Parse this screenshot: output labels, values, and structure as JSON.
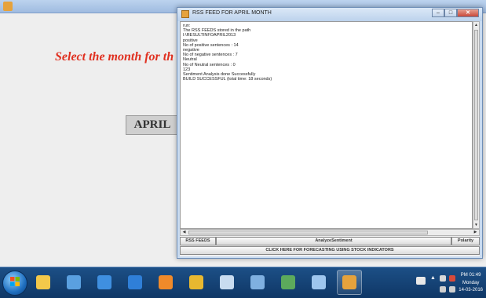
{
  "background_app": {
    "prompt_text": "Select the month for th",
    "month_button_label": "APRIL"
  },
  "rss_window": {
    "title": "RSS FEED FOR APRIL MONTH",
    "window_controls": {
      "minimize": "–",
      "maximize": "□",
      "close": "✕"
    },
    "output_lines": [
      "run:",
      "The RSS FEEDS stored in the path",
      "I:\\RESULTINFOAPRIL2013",
      "positive",
      "No of positive sentences : 14",
      "negative",
      "No of negative sentences : 7",
      "Neutral",
      "No of Neutral sentences : 0",
      "123",
      "Sentiment Analysis done Successfully",
      "BUILD SUCCESSFUL (total time: 18 seconds)"
    ],
    "buttons": {
      "rss_feeds": "RSS FEEDS",
      "analyze_sentiment": "AnalyzeSentiment",
      "polarity": "Polarity",
      "forecasting": "CLICK HERE FOR FORECASTING USING STOCK INDICATORS"
    }
  },
  "taskbar": {
    "items": [
      {
        "name": "file-explorer-icon",
        "color": "#f3c84a"
      },
      {
        "name": "calculator-icon",
        "color": "#5aa0e0"
      },
      {
        "name": "internet-explorer-icon",
        "color": "#3f8fe0"
      },
      {
        "name": "outlook-icon",
        "color": "#2f7fd8"
      },
      {
        "name": "media-player-icon",
        "color": "#f08a2a"
      },
      {
        "name": "chrome-icon",
        "color": "#e8b830"
      },
      {
        "name": "virtualbox-icon",
        "color": "#c9dcf0"
      },
      {
        "name": "document-icon",
        "color": "#7fb0e0"
      },
      {
        "name": "excel-icon",
        "color": "#5caa5c"
      },
      {
        "name": "notepad-icon",
        "color": "#9ec6ee"
      },
      {
        "name": "java-app-icon",
        "color": "#e6a23c"
      }
    ],
    "clock": {
      "time": "PM 01:49",
      "day": "Monday",
      "date": "14-03-2016"
    }
  }
}
